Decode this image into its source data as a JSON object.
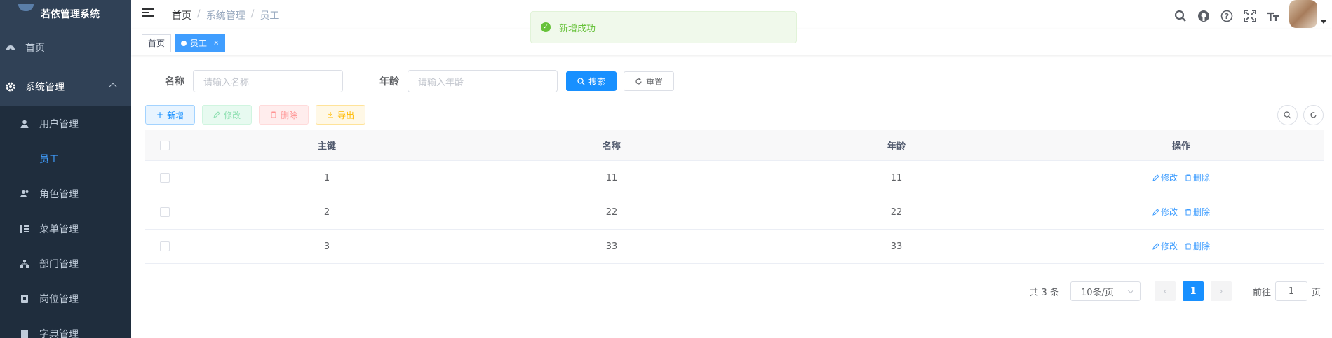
{
  "app": {
    "title": "若依管理系统"
  },
  "sidebar": {
    "items": [
      {
        "label": "首页",
        "icon": "dashboard-icon"
      },
      {
        "label": "系统管理",
        "icon": "gear-icon"
      }
    ],
    "sub_items": [
      {
        "label": "用户管理",
        "icon": "user-icon"
      },
      {
        "label": "员工",
        "icon": ""
      },
      {
        "label": "角色管理",
        "icon": "peoples-icon"
      },
      {
        "label": "菜单管理",
        "icon": "tree-table-icon"
      },
      {
        "label": "部门管理",
        "icon": "tree-icon"
      },
      {
        "label": "岗位管理",
        "icon": "post-icon"
      },
      {
        "label": "字典管理",
        "icon": "dict-icon"
      }
    ]
  },
  "breadcrumb": [
    "首页",
    "系统管理",
    "员工"
  ],
  "tags": [
    {
      "label": "首页",
      "active": false
    },
    {
      "label": "员工",
      "active": true,
      "close": "×"
    }
  ],
  "notification": {
    "text": "新增成功"
  },
  "search": {
    "name_label": "名称",
    "name_placeholder": "请输入名称",
    "age_label": "年龄",
    "age_placeholder": "请输入年龄",
    "search_btn": "搜索",
    "reset_btn": "重置"
  },
  "toolbar": {
    "add": "新增",
    "edit": "修改",
    "delete": "删除",
    "export": "导出"
  },
  "table": {
    "headers": [
      "主键",
      "名称",
      "年龄",
      "操作"
    ],
    "rows": [
      {
        "id": "1",
        "name": "11",
        "age": "11"
      },
      {
        "id": "2",
        "name": "22",
        "age": "22"
      },
      {
        "id": "3",
        "name": "33",
        "age": "33"
      }
    ],
    "op_edit": "修改",
    "op_delete": "删除"
  },
  "pagination": {
    "total": "共 3 条",
    "page_size": "10条/页",
    "current": "1",
    "goto_prefix": "前往",
    "goto_value": "1",
    "goto_suffix": "页"
  },
  "colors": {
    "primary": "#1890ff",
    "sidebar_bg": "#304156",
    "success": "#67c23a"
  }
}
